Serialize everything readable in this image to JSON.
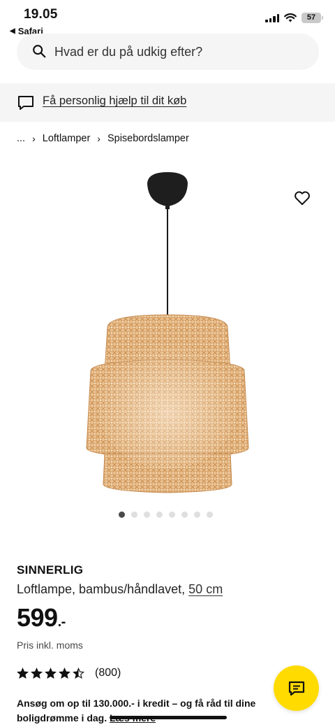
{
  "status_bar": {
    "time": "19.05",
    "back_app": "Safari",
    "battery": "57"
  },
  "search": {
    "placeholder": "Hvad er du på udkig efter?"
  },
  "help_banner": {
    "text": "Få personlig hjælp til dit køb"
  },
  "breadcrumb": {
    "ellipsis": "...",
    "items": [
      "Loftlamper",
      "Spisebordslamper"
    ]
  },
  "gallery": {
    "image_count": 8,
    "active_index": 0
  },
  "product": {
    "name": "SINNERLIG",
    "description": "Loftlampe, bambus/håndlavet,",
    "size": "50 cm",
    "price": "599",
    "price_suffix": ".-",
    "price_note": "Pris inkl. moms",
    "rating_stars": 4.5,
    "rating_count": "(800)"
  },
  "credit": {
    "text": "Ansøg om op til 130.000.- i kredit – og få råd til dine boligdrømme i dag.",
    "link": "Læs mere"
  },
  "colors": {
    "accent_yellow": "#ffdb00",
    "banner_gray": "#f5f5f5",
    "bamboo": "#e3b47e"
  },
  "icons": {
    "search": "search-icon",
    "help": "chat-icon",
    "favorite": "heart-icon",
    "fab": "chat-icon"
  }
}
